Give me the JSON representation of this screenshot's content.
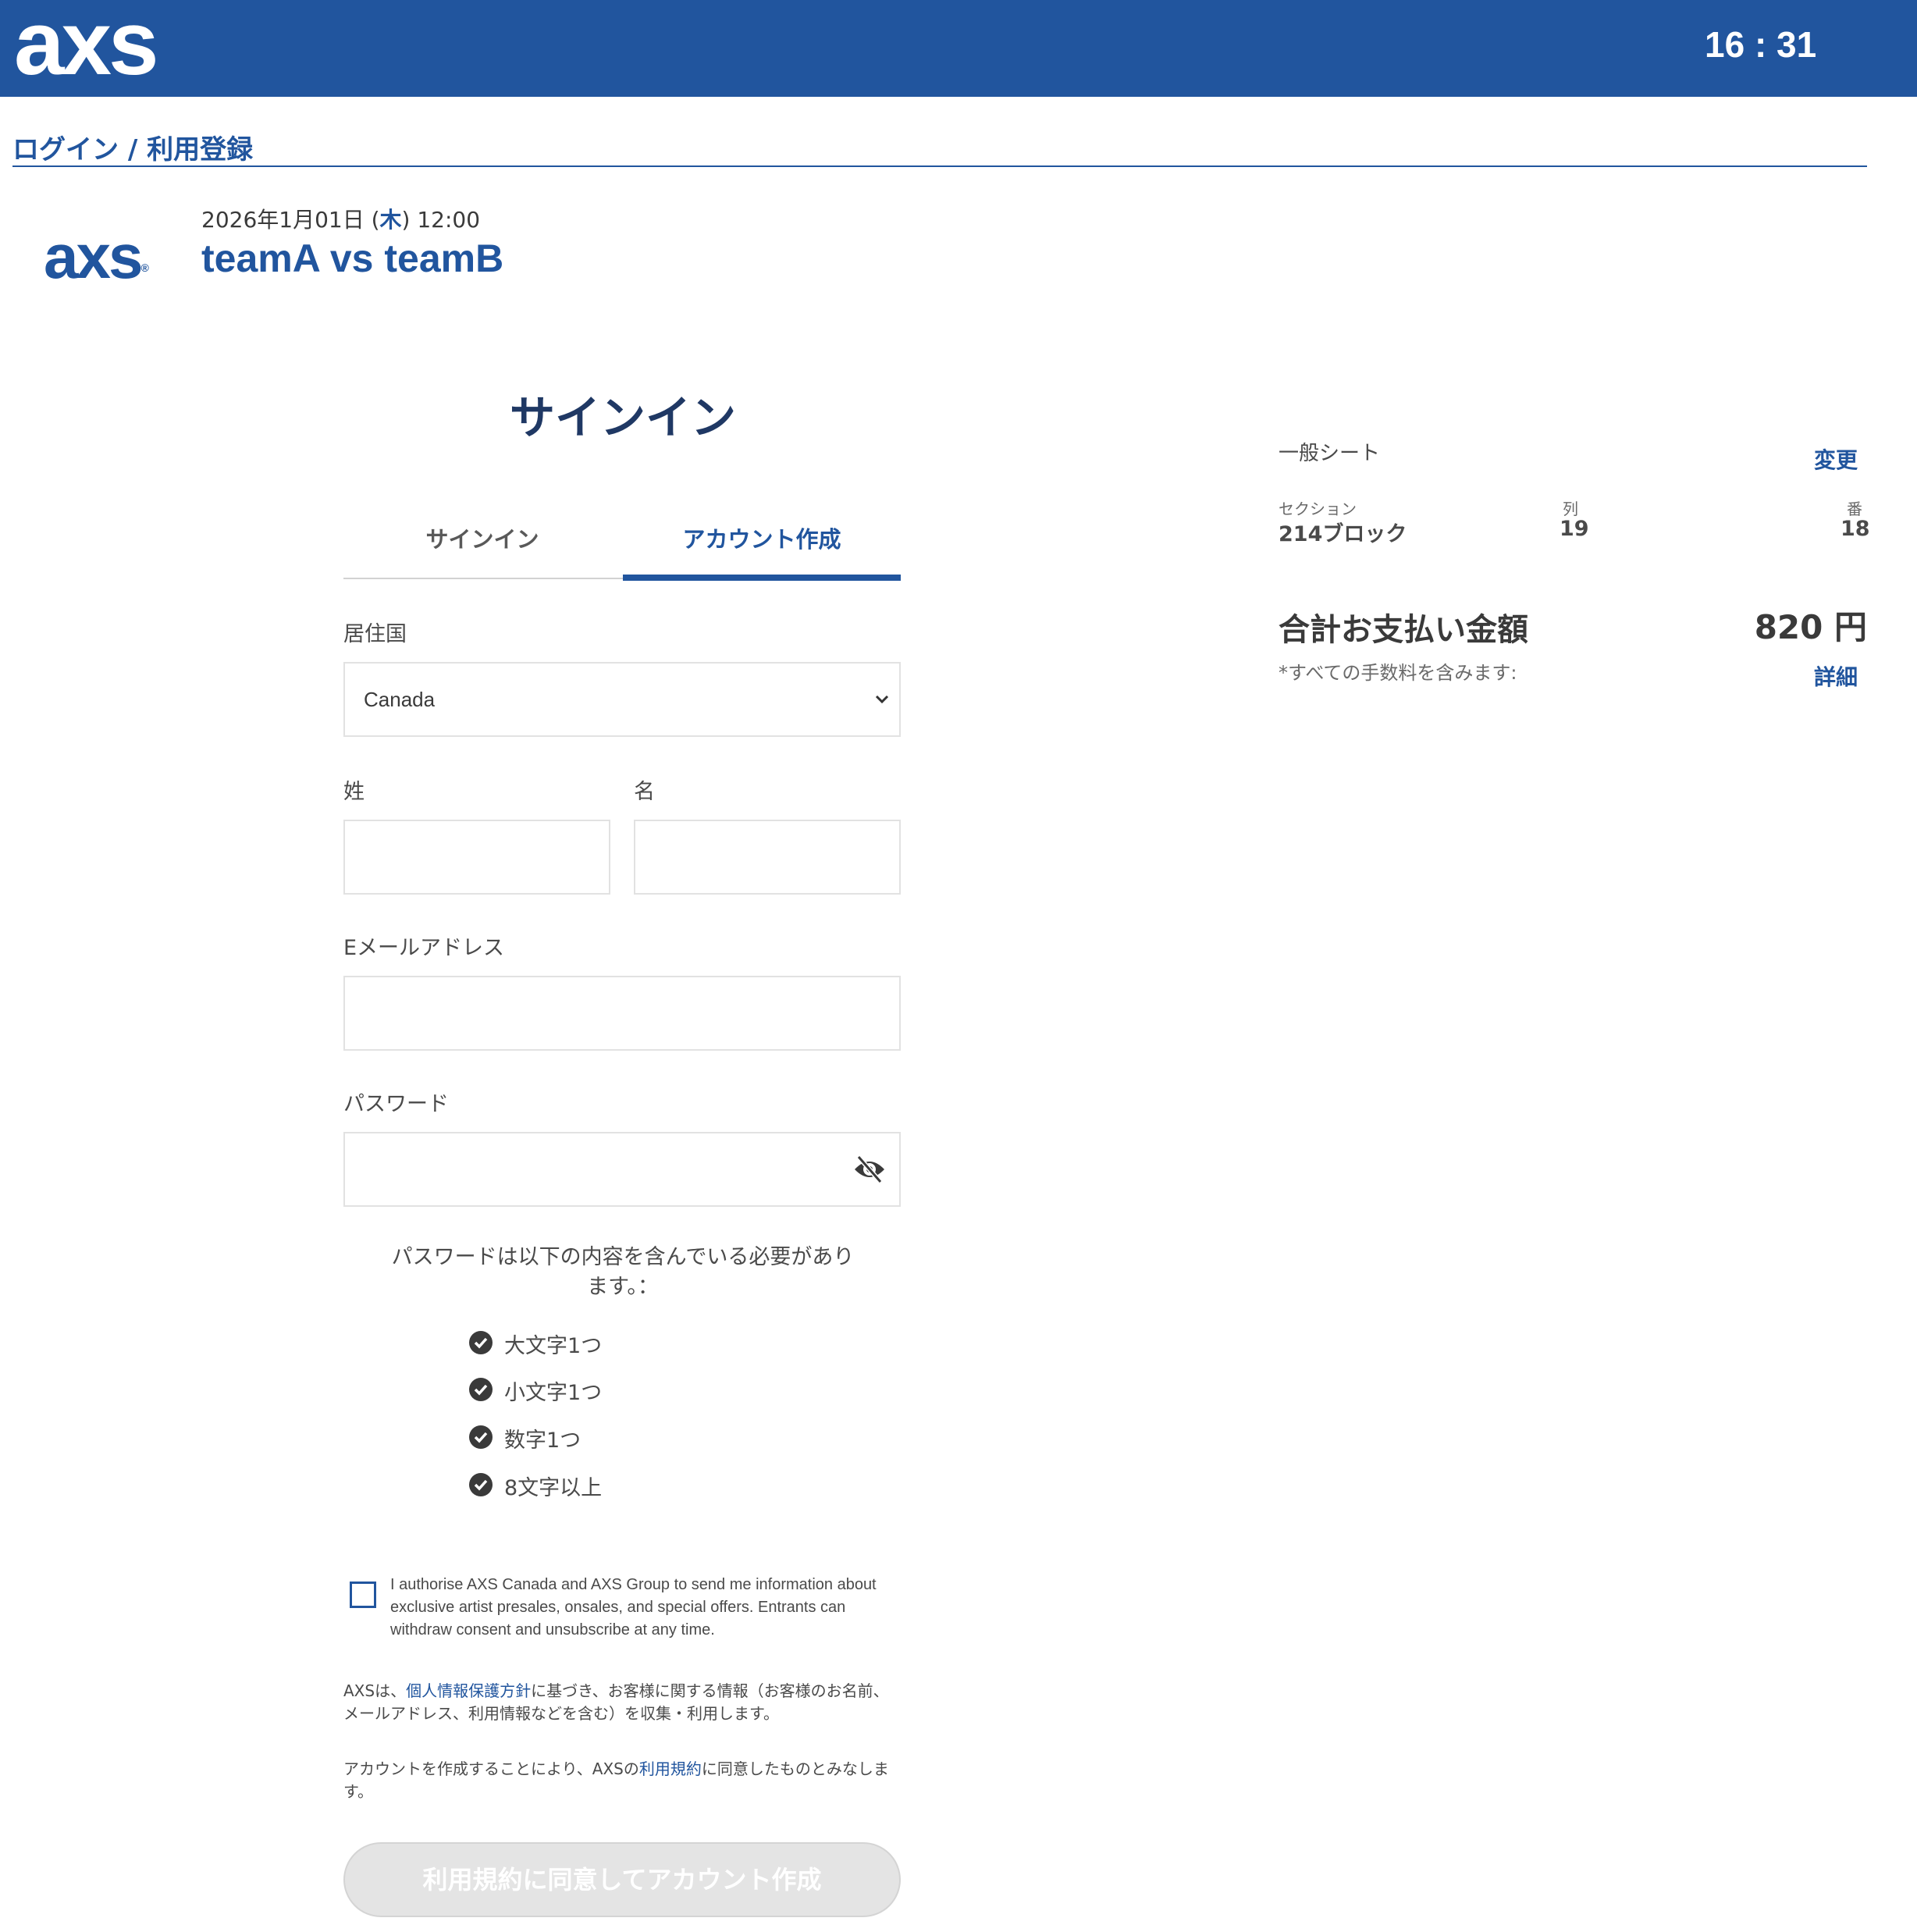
{
  "header": {
    "logo": "axs",
    "timer": "16 : 31"
  },
  "breadcrumb": {
    "title": "ログイン / 利用登録"
  },
  "event": {
    "logo": "axs",
    "date_prefix": "2026年1月01日 (",
    "weekday": "木",
    "date_suffix": ") 12:00",
    "title": "teamA vs teamB"
  },
  "signin": {
    "heading": "サインイン",
    "tabs": [
      {
        "label": "サインイン",
        "active": false
      },
      {
        "label": "アカウント作成",
        "active": true
      }
    ]
  },
  "form": {
    "country": {
      "label": "居住国",
      "value": "Canada"
    },
    "last_name": {
      "label": "姓",
      "value": ""
    },
    "first_name": {
      "label": "名",
      "value": ""
    },
    "email": {
      "label": "Eメールアドレス",
      "value": ""
    },
    "password": {
      "label": "パスワード",
      "value": ""
    }
  },
  "password_rules": {
    "title_line1": "パスワードは以下の内容を含んでいる必要があり",
    "title_line2": "ます。：",
    "items": [
      "大文字1つ",
      "小文字1つ",
      "数字1つ",
      "8文字以上"
    ]
  },
  "consent": {
    "text": "I authorise AXS Canada and AXS Group to send me information about exclusive artist presales, onsales, and special offers. Entrants can withdraw consent and unsubscribe at any time.",
    "checked": false
  },
  "privacy": {
    "prefix": "AXSは、",
    "link": "個人情報保護方針",
    "suffix": "に基づき、お客様に関する情報（お客様のお名前、メールアドレス、利用情報などを含む）を収集・利用します。"
  },
  "terms": {
    "prefix": "アカウントを作成することにより、AXSの",
    "link": "利用規約",
    "suffix": "に同意したものとみなします。"
  },
  "submit": {
    "label": "利用規約に同意してアカウント作成",
    "enabled": false
  },
  "summary": {
    "seat_type": "一般シート",
    "change_link": "変更",
    "section_label": "セクション",
    "section_value": "214ブロック",
    "row_label": "列",
    "row_value": "19",
    "seat_label": "番",
    "seat_value": "18",
    "total_label": "合計お支払い金額",
    "total_value": "820 円",
    "total_note": "*すべての手数料を含みます:",
    "detail_link": "詳細"
  },
  "colors": {
    "brand": "#21559e",
    "heading": "#1f3864",
    "disabled_button": "#e4e4e4"
  },
  "icons": [
    "chevron-down-icon",
    "eye-off-icon",
    "check-circle-icon"
  ]
}
